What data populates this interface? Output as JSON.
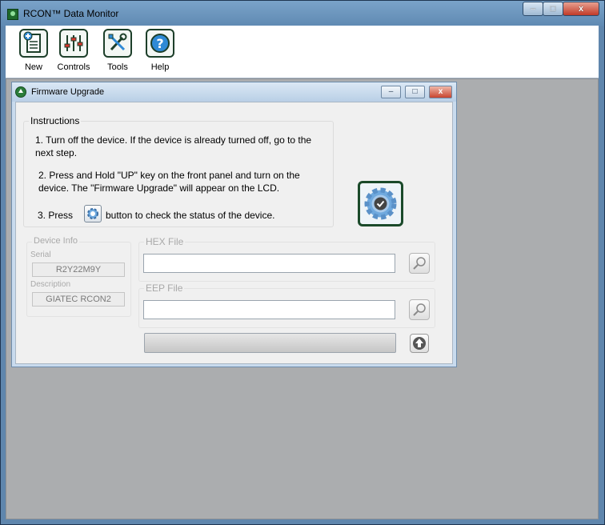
{
  "window": {
    "title": "RCON™ Data Monitor",
    "controls": {
      "minimize": "–",
      "maximize": "□",
      "close": "x"
    }
  },
  "toolbar": {
    "items": [
      {
        "label": "New",
        "icon": "new-document-icon"
      },
      {
        "label": "Controls",
        "icon": "sliders-icon"
      },
      {
        "label": "Tools",
        "icon": "tools-icon"
      },
      {
        "label": "Help",
        "icon": "help-icon"
      }
    ]
  },
  "child_window": {
    "title": "Firmware Upgrade",
    "controls": {
      "minimize": "–",
      "maximize": "□",
      "close": "x"
    }
  },
  "instructions": {
    "heading": "Instructions",
    "step1": "1. Turn off the device. If the device is already turned off, go to the next step.",
    "step2": "2. Press and Hold \"UP\" key on the front panel and turn on the device. The \"Firmware Upgrade\" will appear on the LCD.",
    "step3_prefix": "3. Press",
    "step3_suffix": "button to check the status of the device."
  },
  "device_info": {
    "heading": "Device Info",
    "serial_label": "Serial",
    "serial_value": "R2Y22M9Y",
    "description_label": "Description",
    "description_value": "GIATEC RCON2"
  },
  "hex_file": {
    "heading": "HEX File",
    "value": ""
  },
  "eep_file": {
    "heading": "EEP File",
    "value": ""
  },
  "upgrade": {
    "progress": 0
  },
  "colors": {
    "accent": "#1b4a2a",
    "title_bar": "#6d96bd",
    "mdi_background": "#abadaf"
  }
}
